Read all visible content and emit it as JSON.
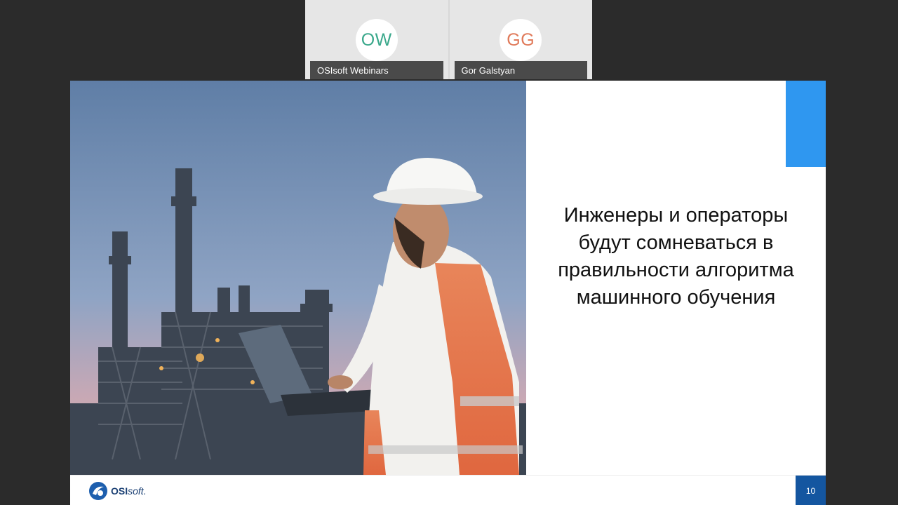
{
  "participants": [
    {
      "initials": "OW",
      "name": "OSIsoft Webinars",
      "initials_color": "#3aa88b"
    },
    {
      "initials": "GG",
      "name": "Gor Galstyan",
      "initials_color": "#e07a5a"
    }
  ],
  "slide": {
    "text_lines": [
      "Инженеры и операторы",
      "будут сомневаться в",
      "правильности алгоритма",
      "машинного обучения"
    ],
    "page_number": "10",
    "logo_text": "OSI",
    "logo_text_soft": "soft.",
    "accent_color": "#2f97f0",
    "page_badge_color": "#1456a0"
  }
}
